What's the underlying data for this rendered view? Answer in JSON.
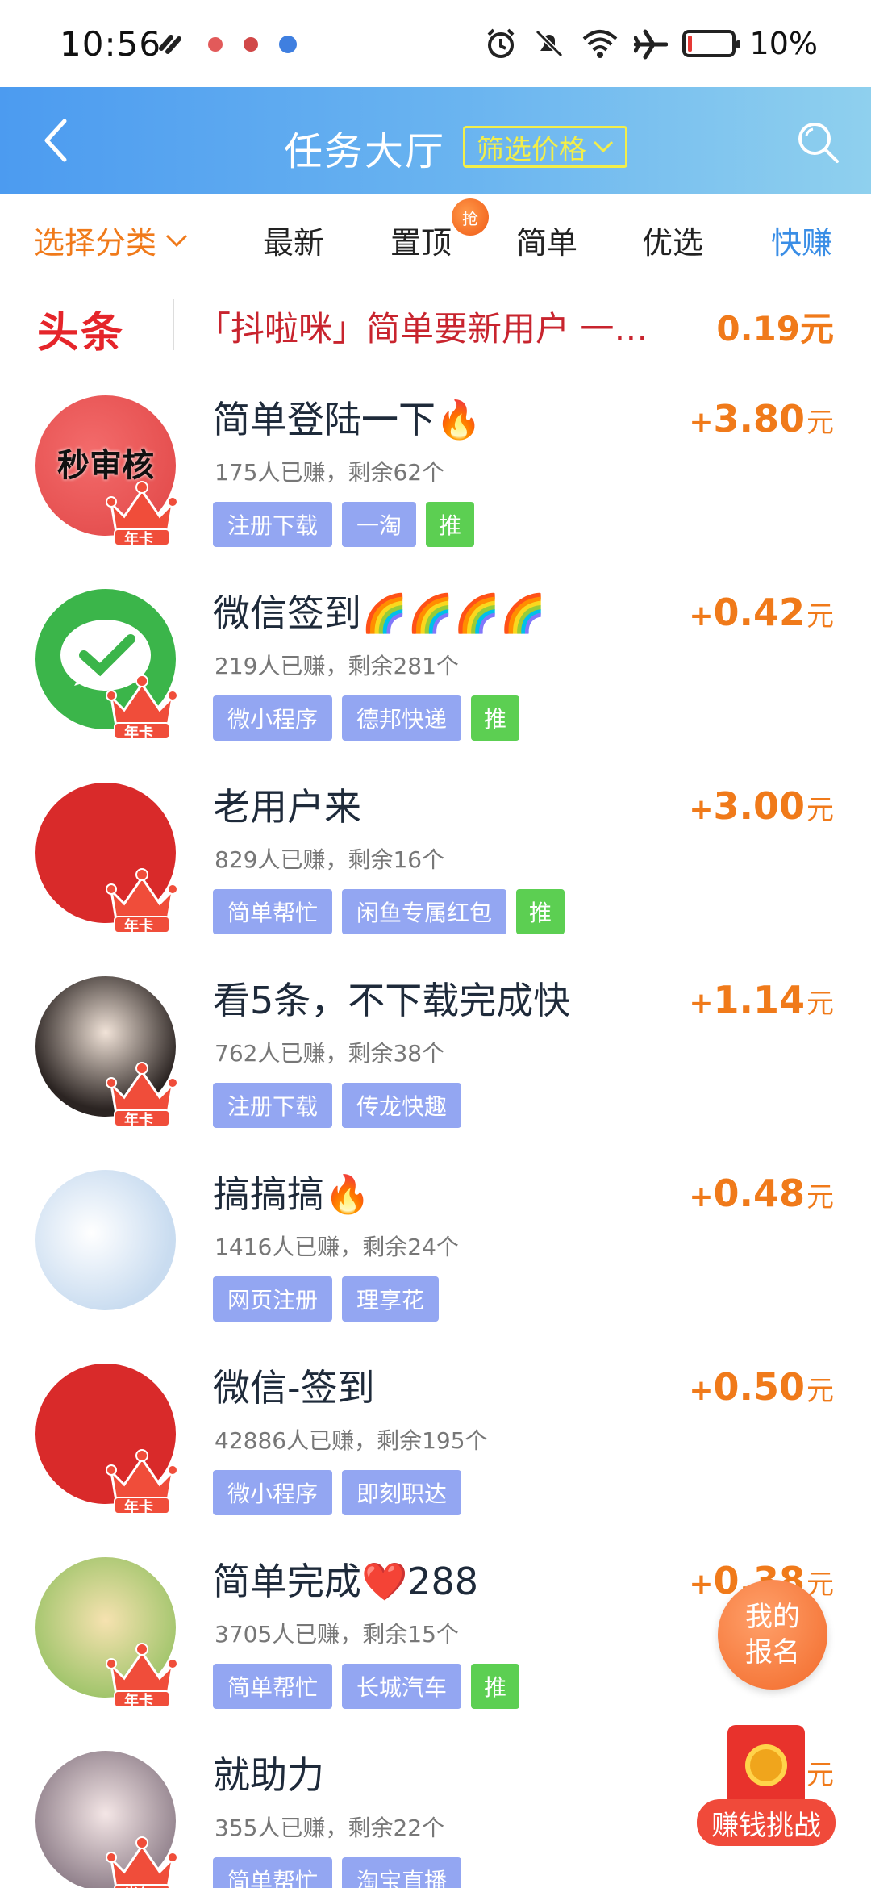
{
  "status_bar": {
    "time": "10:56",
    "battery": "10%",
    "battery_level": 0.1
  },
  "header": {
    "title": "任务大厅",
    "filter_label": "筛选价格"
  },
  "tabs": {
    "category_label": "选择分类",
    "items": [
      "最新",
      "置顶",
      "简单",
      "优选",
      "快赚"
    ],
    "grab_badge": "抢",
    "active_index": 4
  },
  "headline": {
    "logo": "头条",
    "text": "「抖啦咪」简单要新用户 一…",
    "price": "0.19元"
  },
  "tasks": [
    {
      "title": "简单登陆一下🔥",
      "stats": "175人已赚，剩余62个",
      "tags": [
        "注册下载",
        "一淘"
      ],
      "push": "推",
      "plus": "+",
      "amount": "3.80",
      "unit": "元",
      "badge": "年卡",
      "avatar_text": "秒审核"
    },
    {
      "title": "微信签到🌈🌈🌈🌈",
      "stats": "219人已赚，剩余281个",
      "tags": [
        "微小程序",
        "德邦快递"
      ],
      "push": "推",
      "plus": "+",
      "amount": "0.42",
      "unit": "元",
      "badge": "年卡"
    },
    {
      "title": "老用户来",
      "stats": "829人已赚，剩余16个",
      "tags": [
        "简单帮忙",
        "闲鱼专属红包"
      ],
      "push": "推",
      "plus": "+",
      "amount": "3.00",
      "unit": "元",
      "badge": "年卡"
    },
    {
      "title": "看5条，不下载完成快",
      "stats": "762人已赚，剩余38个",
      "tags": [
        "注册下载",
        "传龙快趣"
      ],
      "plus": "+",
      "amount": "1.14",
      "unit": "元",
      "badge": "年卡"
    },
    {
      "title": "搞搞搞🔥",
      "stats": "1416人已赚，剩余24个",
      "tags": [
        "网页注册",
        "理享花"
      ],
      "plus": "+",
      "amount": "0.48",
      "unit": "元"
    },
    {
      "title": "微信-签到",
      "stats": "42886人已赚，剩余195个",
      "tags": [
        "微小程序",
        "即刻职达"
      ],
      "plus": "+",
      "amount": "0.50",
      "unit": "元",
      "badge": "年卡"
    },
    {
      "title": "简单完成❤️288",
      "stats": "3705人已赚，剩余15个",
      "tags": [
        "简单帮忙",
        "长城汽车"
      ],
      "push": "推",
      "plus": "+",
      "amount": "0.38",
      "unit": "元",
      "badge": "年卡"
    },
    {
      "title": "就助力",
      "stats": "355人已赚，剩余22个",
      "tags": [
        "简单帮忙",
        "淘宝直播"
      ],
      "plus": "+",
      "amount": "",
      "unit": "元",
      "badge": "半年"
    }
  ],
  "floating": {
    "my_signup_line1": "我的",
    "my_signup_line2": "报名",
    "challenge": "赚钱挑战"
  },
  "colors": {
    "accent_orange": "#f07a1a",
    "tag_blue": "#93a6f2",
    "tag_green": "#5ccf52",
    "headline_red": "#c8242e",
    "header_blue": "#4c9bf0"
  }
}
